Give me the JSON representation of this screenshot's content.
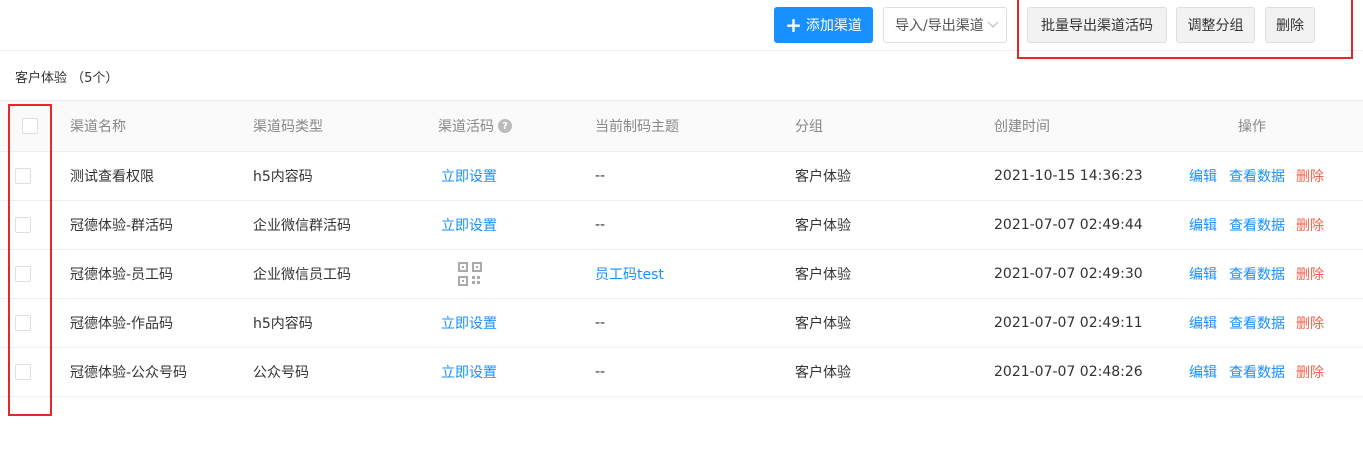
{
  "toolbar": {
    "add_label": "添加渠道",
    "import_export_label": "导入/导出渠道",
    "batch_export_label": "批量导出渠道活码",
    "adjust_group_label": "调整分组",
    "delete_label": "删除"
  },
  "group": {
    "title": "客户体验 （5个）"
  },
  "table": {
    "columns": {
      "name": "渠道名称",
      "code_type": "渠道码类型",
      "live_code": "渠道活码",
      "theme": "当前制码主题",
      "group": "分组",
      "created": "创建时间",
      "actions": "操作"
    },
    "action_labels": {
      "edit": "编辑",
      "view_data": "查看数据",
      "delete": "删除"
    },
    "rows": [
      {
        "name": "测试查看权限",
        "code_type": "h5内容码",
        "live_code": "立即设置",
        "theme": "--",
        "group": "客户体验",
        "created": "2021-10-15 14:36:23"
      },
      {
        "name": "冠德体验-群活码",
        "code_type": "企业微信群活码",
        "live_code": "立即设置",
        "theme": "--",
        "group": "客户体验",
        "created": "2021-07-07 02:49:44"
      },
      {
        "name": "冠德体验-员工码",
        "code_type": "企业微信员工码",
        "live_code": "",
        "theme": "员工码test",
        "group": "客户体验",
        "created": "2021-07-07 02:49:30"
      },
      {
        "name": "冠德体验-作品码",
        "code_type": "h5内容码",
        "live_code": "立即设置",
        "theme": "--",
        "group": "客户体验",
        "created": "2021-07-07 02:49:11"
      },
      {
        "name": "冠德体验-公众号码",
        "code_type": "公众号码",
        "live_code": "立即设置",
        "theme": "--",
        "group": "客户体验",
        "created": "2021-07-07 02:48:26"
      }
    ]
  },
  "colors": {
    "primary": "#1890ff",
    "danger": "#f5614d",
    "highlight": "#e5262a"
  }
}
